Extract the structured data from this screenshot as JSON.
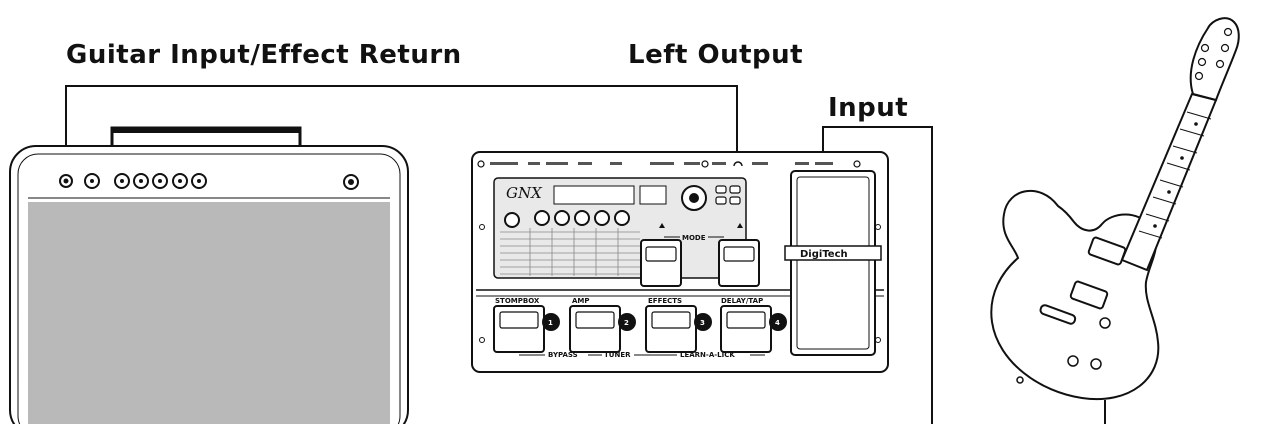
{
  "labels": {
    "amp_input": "Guitar Input/Effect Return",
    "left_output": "Left Output",
    "input": "Input"
  },
  "processor": {
    "logo": "GNX",
    "brand": "DigiTech",
    "footswitches": [
      "STOMPBOX",
      "AMP",
      "EFFECTS",
      "DELAY/TAP"
    ],
    "footswitch_numbers": [
      "1",
      "2",
      "3",
      "4"
    ],
    "bottom_row": [
      "BYPASS",
      "TUNER",
      "LEARN-A-LICK"
    ],
    "mode": "MODE"
  },
  "colors": {
    "line": "#111111",
    "grille": "#b9b9b9",
    "panel": "#ffffff"
  }
}
